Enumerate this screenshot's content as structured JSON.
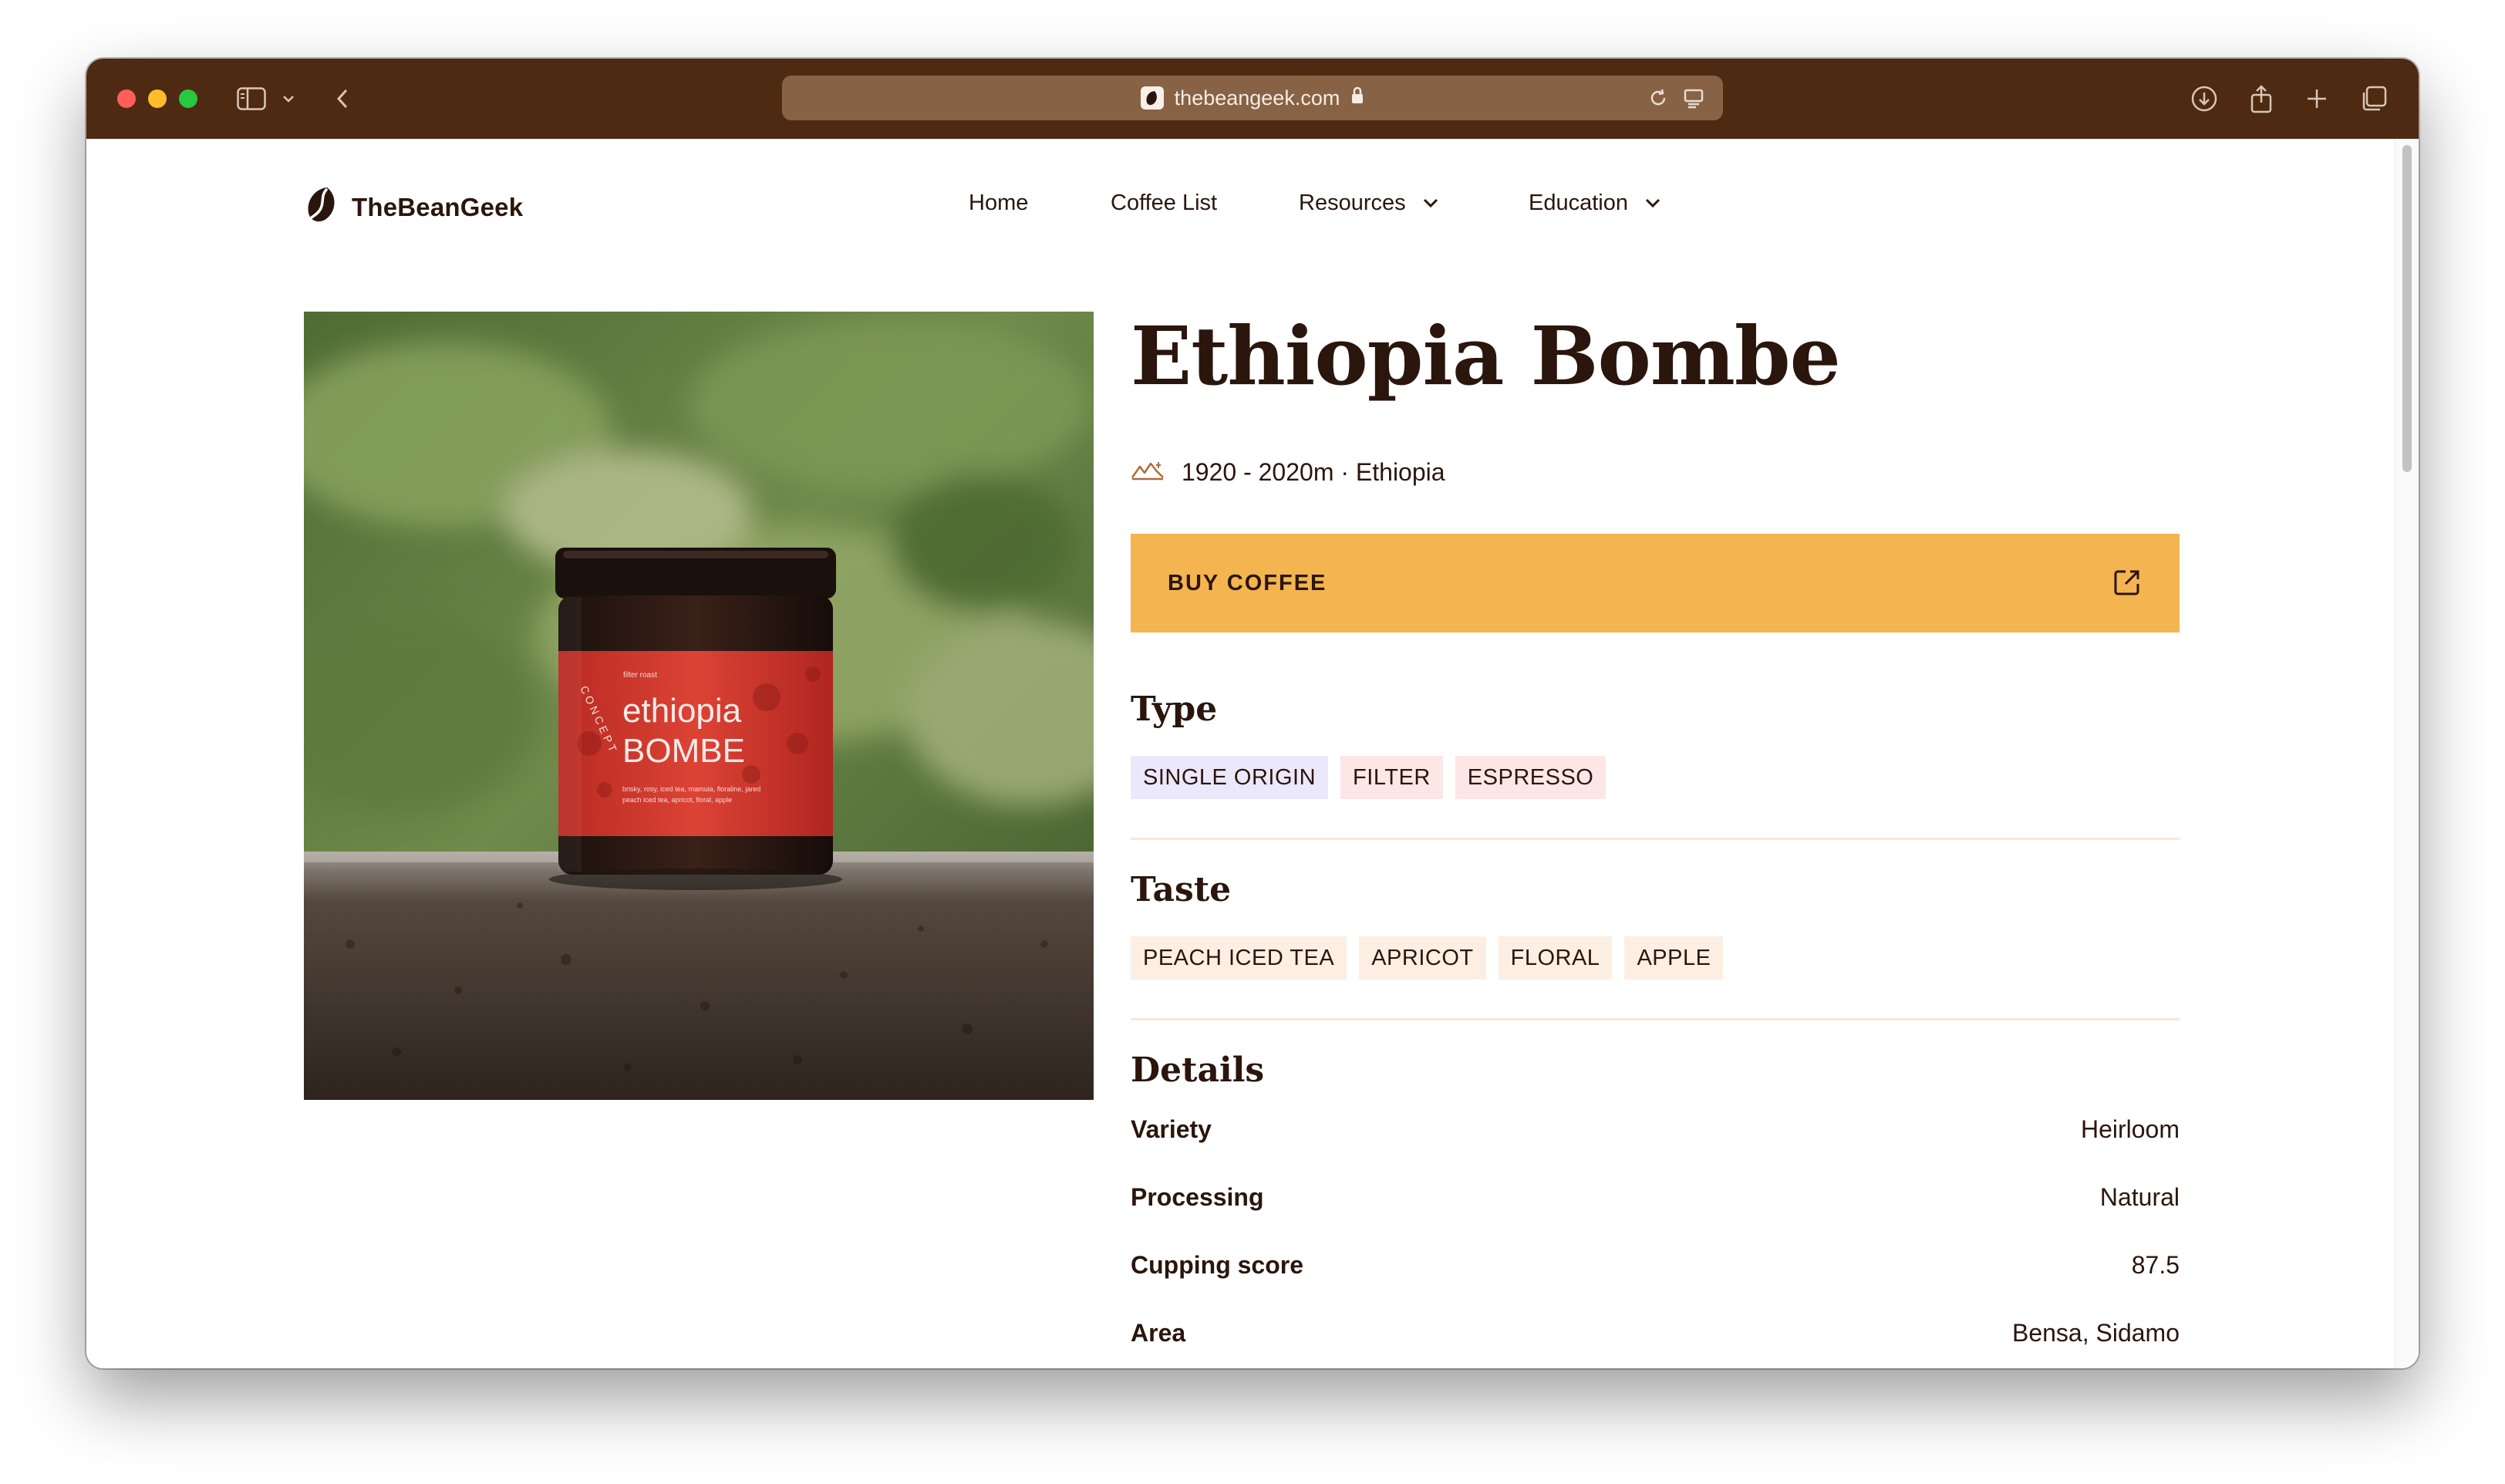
{
  "browser": {
    "url": "thebeangeek.com"
  },
  "site": {
    "logo_text": "TheBeanGeek",
    "nav": [
      {
        "label": "Home",
        "has_dropdown": false
      },
      {
        "label": "Coffee List",
        "has_dropdown": false
      },
      {
        "label": "Resources",
        "has_dropdown": true
      },
      {
        "label": "Education",
        "has_dropdown": true
      }
    ]
  },
  "product": {
    "title": "Ethiopia Bombe",
    "meta": "1920 - 2020m · Ethiopia",
    "buy_label": "BUY COFFEE",
    "jar_label": {
      "line1": "ethiopia",
      "line2": "BOMBE",
      "small": "filter roast",
      "brand": "CONCEPT",
      "notes_line1": "brisky, rosy, iced tea, mamuia, floraline, jared",
      "notes_line2": "peach iced tea, apricot, floral, apple"
    }
  },
  "type_section": {
    "title": "Type",
    "tags": [
      {
        "label": "SINGLE ORIGIN",
        "color": "#ebe8fb"
      },
      {
        "label": "FILTER",
        "color": "#fde6e6"
      },
      {
        "label": "ESPRESSO",
        "color": "#fde6e6"
      }
    ]
  },
  "taste_section": {
    "title": "Taste",
    "tags": [
      {
        "label": "PEACH ICED TEA",
        "color": "#fdeee4"
      },
      {
        "label": "APRICOT",
        "color": "#fdeee4"
      },
      {
        "label": "FLORAL",
        "color": "#fdeee4"
      },
      {
        "label": "APPLE",
        "color": "#fdeee4"
      }
    ]
  },
  "details_section": {
    "title": "Details",
    "rows": [
      {
        "key": "Variety",
        "value": "Heirloom"
      },
      {
        "key": "Processing",
        "value": "Natural"
      },
      {
        "key": "Cupping score",
        "value": "87.5"
      },
      {
        "key": "Area",
        "value": "Bensa, Sidamo"
      }
    ]
  },
  "colors": {
    "toolbar": "#4e2a12",
    "address_bar": "#876245",
    "accent_button": "#f4b450",
    "text_dark": "#2a160c",
    "divider": "#f8e7db"
  }
}
